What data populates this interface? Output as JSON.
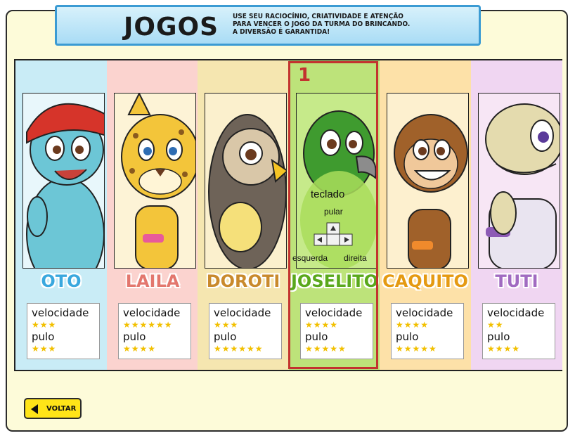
{
  "banner": {
    "title": "JOGOS",
    "text_line1": "USE SEU RACIOCÍNIO, CRIATIVIDADE E ATENÇÃO",
    "text_line2": "PARA VENCER O JOGO DA TURMA DO BRINCANDO.",
    "text_line3": "A DIVERSÃO É GARANTIDA!",
    "color": "#a9dcf5"
  },
  "characters": [
    {
      "name": "OTO",
      "speed_label": "velocidade",
      "jump_label": "pulo",
      "speed_stars": 3,
      "jump_stars": 3,
      "name_color": "#3aa8de",
      "bg": "#c9ecf6",
      "body_color": "#6cc6d6"
    },
    {
      "name": "LAILA",
      "speed_label": "velocidade",
      "jump_label": "pulo",
      "speed_stars": 6,
      "jump_stars": 4,
      "name_color": "#e3776e",
      "bg": "#fbd3cf",
      "body_color": "#f3c53a"
    },
    {
      "name": "DOROTI",
      "speed_label": "velocidade",
      "jump_label": "pulo",
      "speed_stars": 3,
      "jump_stars": 6,
      "name_color": "#c98a2c",
      "bg": "#f5e6b0",
      "body_color": "#6e6358"
    },
    {
      "name": "JOSELITO",
      "speed_label": "velocidade",
      "jump_label": "pulo",
      "speed_stars": 4,
      "jump_stars": 5,
      "name_color": "#5aa81c",
      "bg": "#bde37a",
      "body_color": "#3f9b2f"
    },
    {
      "name": "CAQUITO",
      "speed_label": "velocidade",
      "jump_label": "pulo",
      "speed_stars": 4,
      "jump_stars": 5,
      "name_color": "#e59a12",
      "bg": "#fde1a8",
      "body_color": "#a0612a"
    },
    {
      "name": "TUTI",
      "speed_label": "velocidade",
      "jump_label": "pulo",
      "speed_stars": 2,
      "jump_stars": 4,
      "name_color": "#a16bc1",
      "bg": "#f0d6f2",
      "body_color": "#e4dbae"
    }
  ],
  "selection": {
    "number": "1",
    "selected_character": "JOSELITO",
    "controls_title": "teclado",
    "jump_key": "pular",
    "left_key": "esquerda",
    "right_key": "direita",
    "border_color": "#c3332f"
  },
  "back_button": {
    "label": "VOLTAR",
    "icon": "back-arrow-icon",
    "color": "#ffe418"
  }
}
